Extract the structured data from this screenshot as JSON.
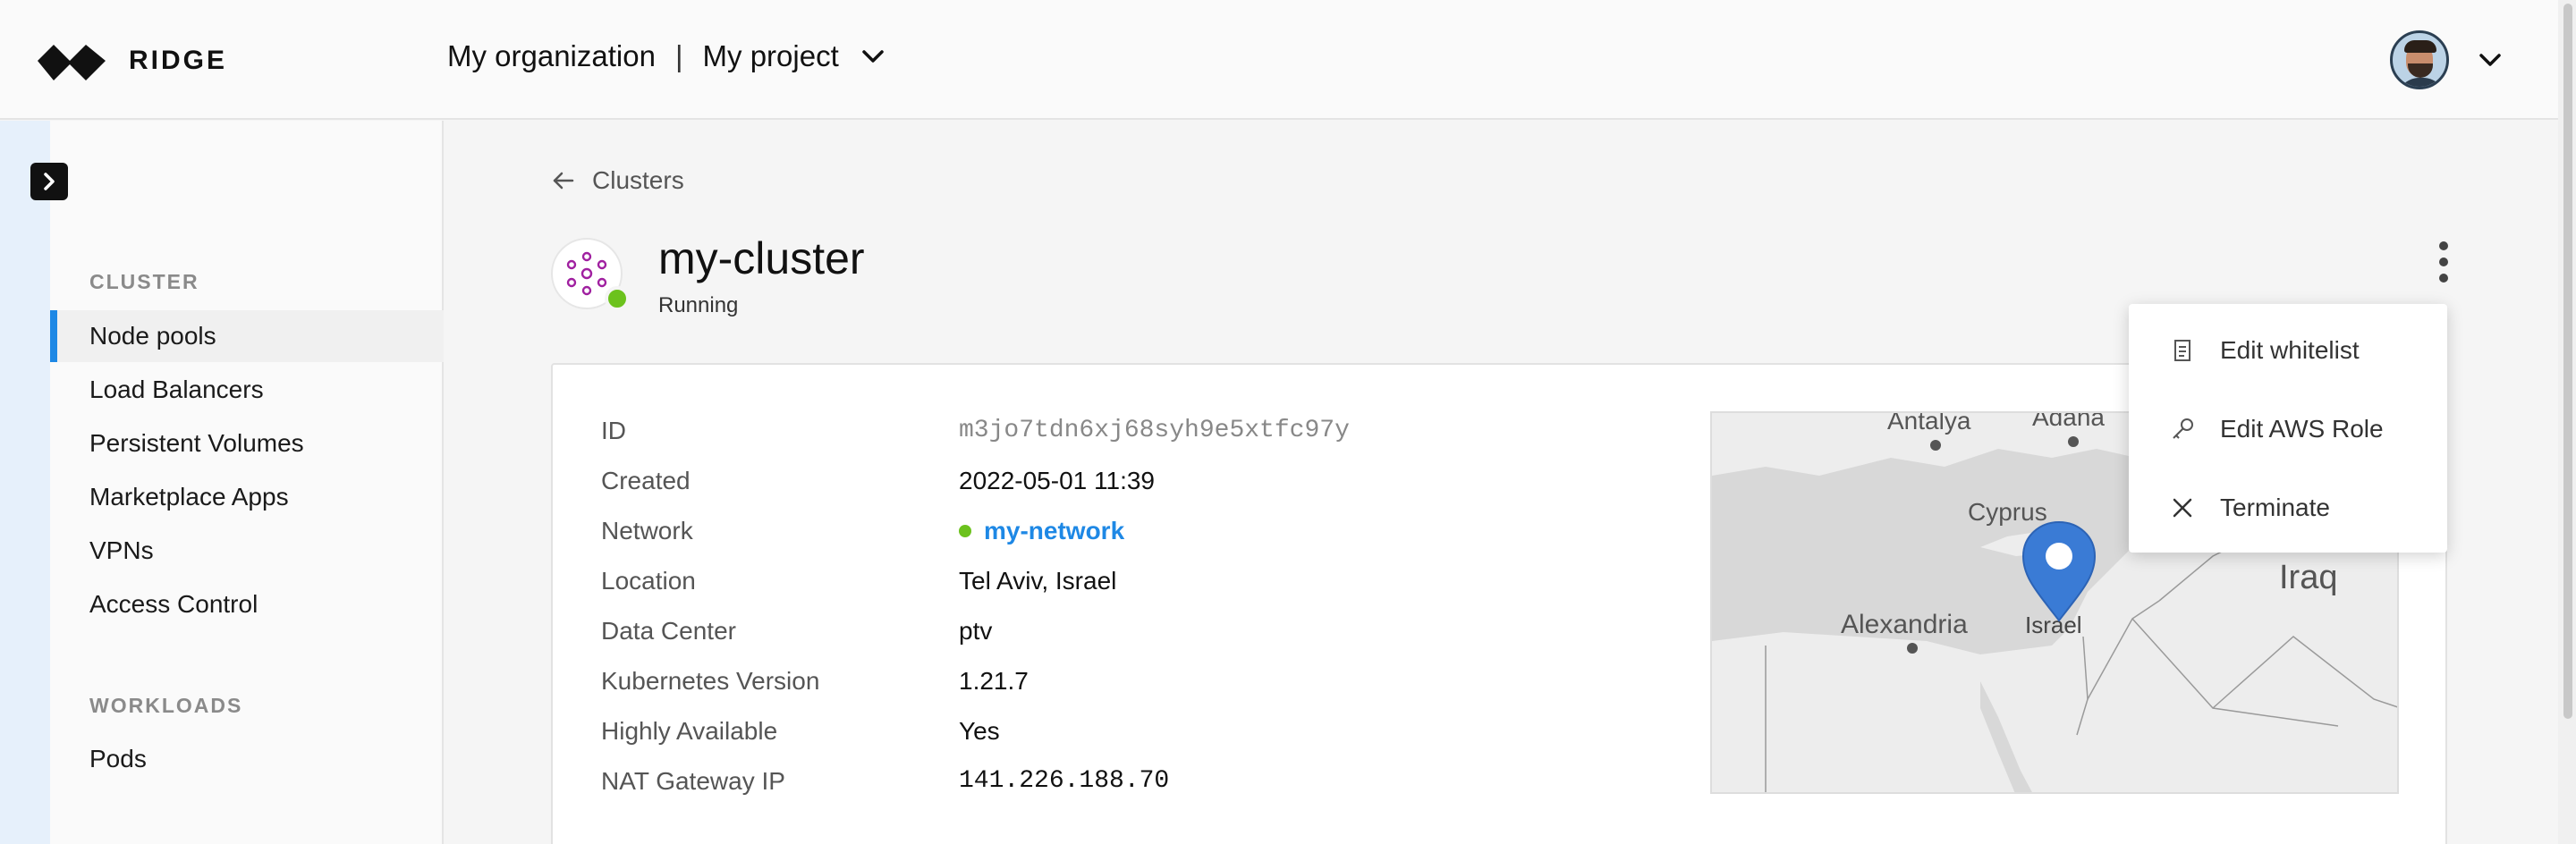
{
  "brand": {
    "name": "RIDGE",
    "accent": "#1e88e5"
  },
  "header": {
    "organization": "My organization",
    "separator": "|",
    "project": "My project",
    "project_chevron_icon": "chevron-down-icon",
    "user_chevron_icon": "chevron-down-icon"
  },
  "sidebar": {
    "toggle_icon": "chevron-right-icon",
    "sections": [
      {
        "heading": "CLUSTER",
        "items": [
          {
            "label": "Node pools",
            "active": true
          },
          {
            "label": "Load Balancers"
          },
          {
            "label": "Persistent Volumes"
          },
          {
            "label": "Marketplace Apps"
          },
          {
            "label": "VPNs"
          },
          {
            "label": "Access Control"
          }
        ]
      },
      {
        "heading": "WORKLOADS",
        "items": [
          {
            "label": "Pods"
          }
        ]
      }
    ]
  },
  "breadcrumb": {
    "label": "Clusters",
    "icon": "arrow-left-icon"
  },
  "cluster": {
    "name": "my-cluster",
    "status": "Running",
    "status_color": "#6cc21d",
    "icon": "cluster-icon",
    "icon_color": "#a020a0"
  },
  "details": [
    {
      "label": "ID",
      "value": "m3jo7tdn6xj68syh9e5xtfc97y"
    },
    {
      "label": "Created",
      "value": "2022-05-01 11:39"
    },
    {
      "label": "Network",
      "value": "my-network"
    },
    {
      "label": "Location",
      "value": "Tel Aviv, Israel"
    },
    {
      "label": "Data Center",
      "value": "ptv"
    },
    {
      "label": "Kubernetes Version",
      "value": "1.21.7"
    },
    {
      "label": "Highly Available",
      "value": "Yes"
    },
    {
      "label": "NAT Gateway IP",
      "value": "141.226.188.70"
    }
  ],
  "map": {
    "labels": [
      "Antalya",
      "Adana",
      "Cyprus",
      "Iraq",
      "Alexandria",
      "Israel"
    ],
    "pin_color": "#3a7bd5"
  },
  "actions_menu": {
    "trigger_icon": "kebab-menu-icon",
    "items": [
      {
        "label": "Edit whitelist",
        "icon": "document-icon"
      },
      {
        "label": "Edit AWS Role",
        "icon": "key-icon"
      },
      {
        "label": "Terminate",
        "icon": "close-icon"
      }
    ]
  }
}
